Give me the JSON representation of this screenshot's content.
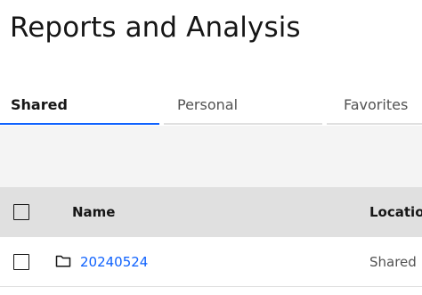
{
  "page": {
    "title": "Reports and Analysis"
  },
  "tabs": [
    {
      "label": "Shared",
      "active": true
    },
    {
      "label": "Personal",
      "active": false
    },
    {
      "label": "Favorites",
      "active": false
    }
  ],
  "table": {
    "columns": [
      "Name",
      "Location"
    ],
    "rows": [
      {
        "name": "20240524",
        "type": "folder-icon",
        "location": "Shared"
      }
    ]
  },
  "colors": {
    "accent": "#0f62fe",
    "header_bg": "#e0e0e0",
    "toolbar_bg": "#f4f4f4"
  }
}
